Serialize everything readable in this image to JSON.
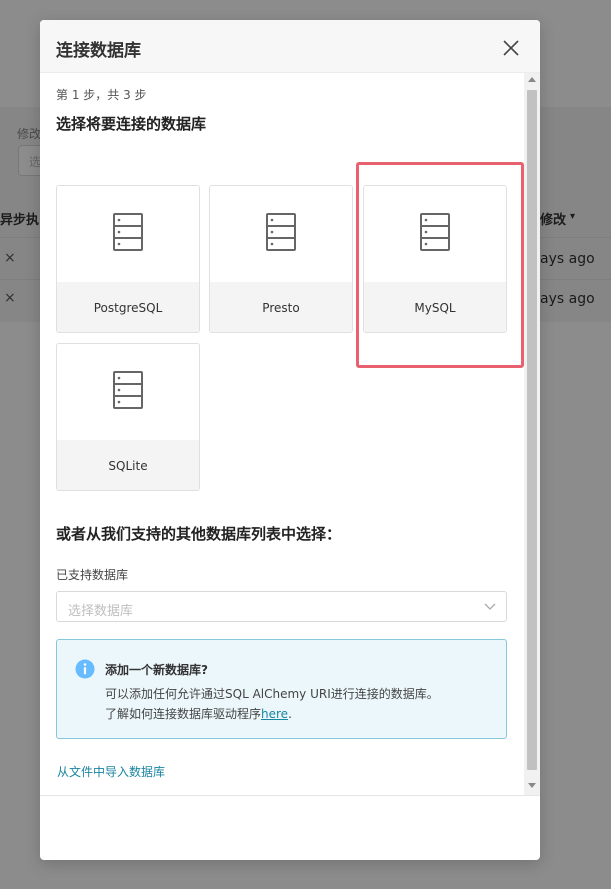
{
  "background": {
    "filter_label": "修改",
    "filter_placeholder": "选",
    "col_async": "异步执",
    "col_modified": "修改",
    "sort_caret": "▾",
    "rows": [
      {
        "remove": "×",
        "modified": "ays ago"
      },
      {
        "remove": "×",
        "modified": "ays ago"
      }
    ]
  },
  "modal": {
    "title": "连接数据库",
    "close_glyph": "×",
    "step_label": "第 1 步，共 3 步",
    "step_heading": "选择将要连接的数据库",
    "databases": [
      {
        "label": "PostgreSQL",
        "icon": "database-server-icon"
      },
      {
        "label": "Presto",
        "icon": "database-server-icon"
      },
      {
        "label": "MySQL",
        "icon": "database-server-icon",
        "highlighted": true
      },
      {
        "label": "SQLite",
        "icon": "database-server-icon"
      }
    ],
    "other_heading": "或者从我们支持的其他数据库列表中选择：",
    "supported_label": "已支持数据库",
    "select_placeholder": "选择数据库",
    "info": {
      "icon": "info-icon",
      "title": "添加一个新数据库?",
      "line1": "可以添加任何允许通过SQL AlChemy URI进行连接的数据库。",
      "line2_prefix": "了解如何连接数据库驱动程序",
      "link_text": "here",
      "line2_suffix": "."
    },
    "import_link": "从文件中导入数据库"
  },
  "colors": {
    "highlight": "#e8616e",
    "link": "#1a85a0",
    "info_bg": "#ecf7fb",
    "info_border": "#86c7dc",
    "info_icon": "#66bcfe"
  }
}
